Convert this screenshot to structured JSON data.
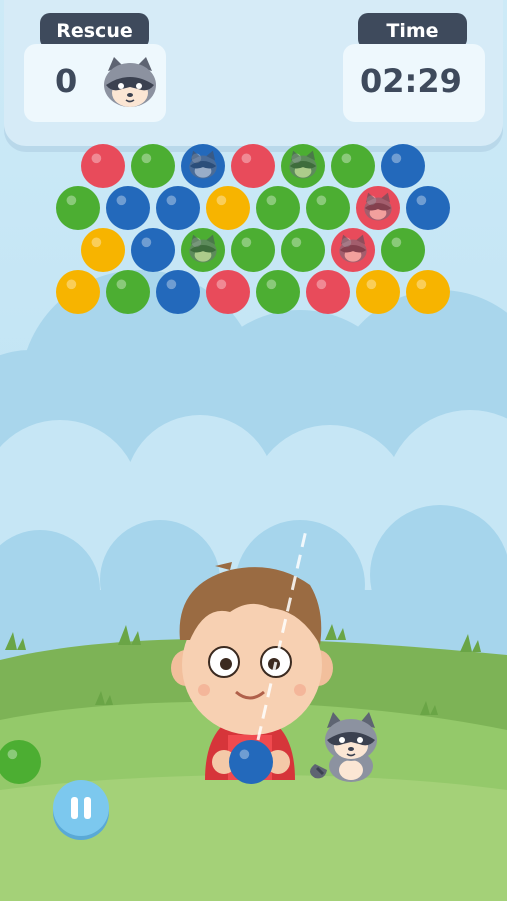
{
  "hud": {
    "rescue_label": "Rescue",
    "rescue_count": "0",
    "time_label": "Time",
    "time_value": "02:29"
  },
  "controls": {
    "pause_icon": "pause-icon"
  },
  "colors": {
    "red": "#e84b5b",
    "green": "#4cae32",
    "blue": "#2369bb",
    "yellow": "#f7b400",
    "sky": "#bfe3f3",
    "grass": "#8fc460",
    "hud_dark": "#3e4a5c"
  },
  "bubble_grid": {
    "rows": [
      [
        "red",
        "green",
        "blue-raccoon",
        "red",
        "green-raccoon",
        "green",
        "blue"
      ],
      [
        "green",
        "blue",
        "blue",
        "yellow",
        "green",
        "green",
        "red-raccoon",
        "blue"
      ],
      [
        "yellow",
        "blue",
        "green-raccoon",
        "green",
        "green",
        "red-raccoon",
        "green"
      ],
      [
        "yellow",
        "green",
        "blue",
        "red",
        "green",
        "red",
        "yellow",
        "yellow"
      ]
    ]
  },
  "shooter": {
    "current_bubble": "blue",
    "next_bubble": "green"
  }
}
